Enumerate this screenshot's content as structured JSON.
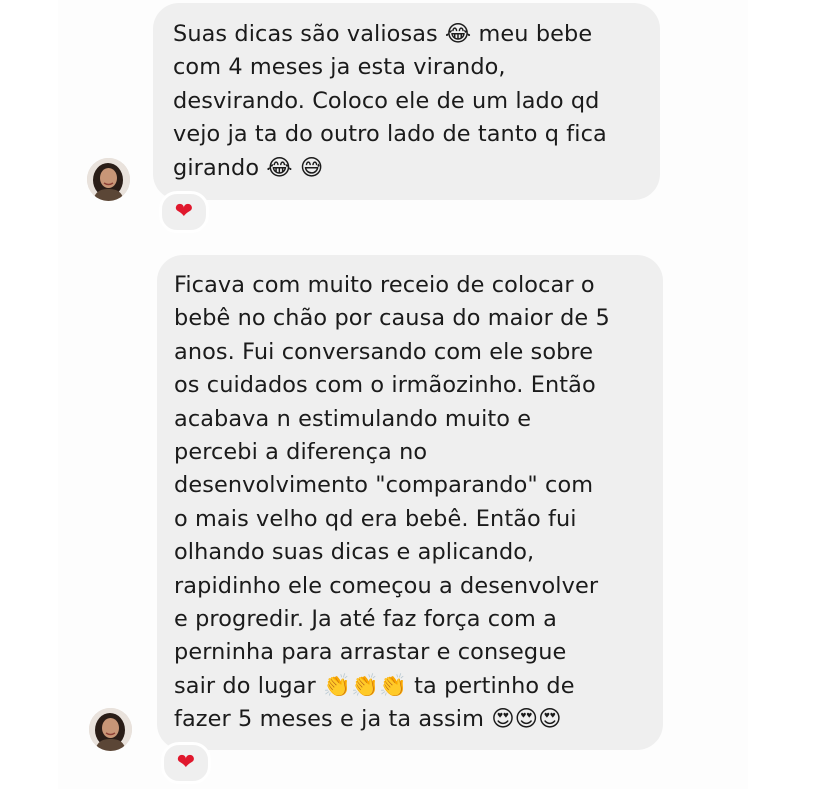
{
  "messages": [
    {
      "lines": [
        "Suas dicas são valiosas 😂  meu bebe",
        "com 4 meses ja esta virando,",
        "desvirando. Coloco ele de um lado qd",
        "vejo ja ta do outro lado de tanto q fica",
        "girando 😂 😅"
      ],
      "reaction": "❤"
    },
    {
      "lines": [
        "Ficava com muito receio de colocar o",
        "bebê no chão por causa do maior de 5",
        "anos. Fui conversando com ele sobre",
        "os cuidados com o irmãozinho. Então",
        "acabava n estimulando muito e",
        "percebi a diferença no",
        "desenvolvimento \"comparando\" com",
        "o mais velho qd era bebê. Então fui",
        "olhando suas dicas e aplicando,",
        "rapidinho ele começou a desenvolver",
        "e progredir. Ja até faz força com a",
        "perninha para arrastar e consegue",
        "sair do lugar 👏👏👏 ta pertinho de",
        "fazer 5 meses e ja ta assim 😍😍😍"
      ],
      "reaction": "❤"
    }
  ],
  "colors": {
    "bubble": "#efefef",
    "text": "#1b1b1b",
    "heart": "#e0182d",
    "background": "#ffffff"
  },
  "icons": {
    "avatar": "user-avatar-photo",
    "reaction": "red-heart-icon"
  }
}
